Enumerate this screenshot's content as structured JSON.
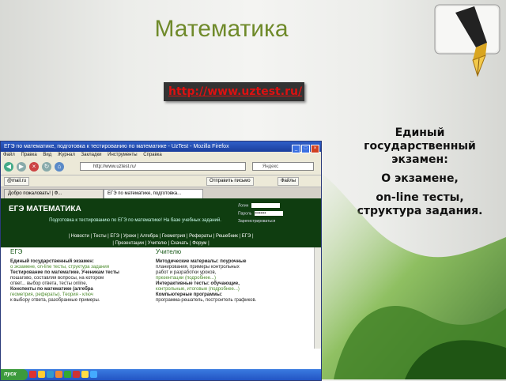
{
  "slide": {
    "title": "Математика",
    "link": "http://www.uztest.ru/",
    "side_lines": [
      "Единый государственный экзамен:",
      "О экзамене,",
      "on-line тесты, структура задания."
    ]
  },
  "browser": {
    "title": "ЕГЭ по математике, подготовка к тестированию по математике - UzTest - Mozilla Firefox",
    "menu": [
      "Файл",
      "Правка",
      "Вид",
      "Журнал",
      "Закладки",
      "Инструменты",
      "Справка"
    ],
    "address": "http://www.uztest.ru/",
    "search_placeholder": "Яндекс",
    "bookmarks": [
      "@mail.ru",
      "Отправить письмо",
      "Файлы"
    ],
    "tabs": [
      "Добро пожаловать! | Ф...",
      "ЕГЭ по математике, подготовка..."
    ]
  },
  "site": {
    "logo": "ЕГЭ МАТЕМАТИКА",
    "subtitle": "Подготовка к тестированию по ЕГЭ по математике! На базе учебных заданий.",
    "login_label": "Логин",
    "password_label": "Пароль",
    "login_value": "",
    "password_value": "••••••••",
    "register_link": "Зарегистрироваться",
    "nav_line1": "| Новости | Тесты | ЕГЭ | Уроки | Алгебра | Геометрия | Рефераты | Решебник | ЕГЭ |",
    "nav_line2": "| Презентации | Учителю | Скачать | Форум |",
    "col_left": {
      "heading": "ЕГЭ",
      "lines": [
        "Единый государственный экзамен:",
        "о экзамене, on-line тесты, структура задания",
        "Тестирование по математике. Ученикам тесты",
        "пошагово, составляя вопросы, на котором",
        "ответ... выбор ответа, тесты online,",
        "Конспекты по математике (алгебра",
        "геометрия, рефераты). Теория - ключ",
        "к выбору ответа, разобранные примеры."
      ]
    },
    "col_right": {
      "heading": "Учителю",
      "lines": [
        "Методические материалы: поурочные",
        "планирования, примеры контрольных",
        "работ и разработки уроков,",
        "презентации (подробнее...)",
        "Интерактивные тесты: обучающие,",
        "контрольные, итоговые (подробнее...)",
        "Компьютерные программы:",
        "программа-решатель, построитель графиков."
      ]
    }
  },
  "taskbar": {
    "start": "пуск"
  },
  "colors": {
    "title": "#6f8a2a",
    "link": "#dd1111",
    "site_bg": "#0f3d10"
  }
}
